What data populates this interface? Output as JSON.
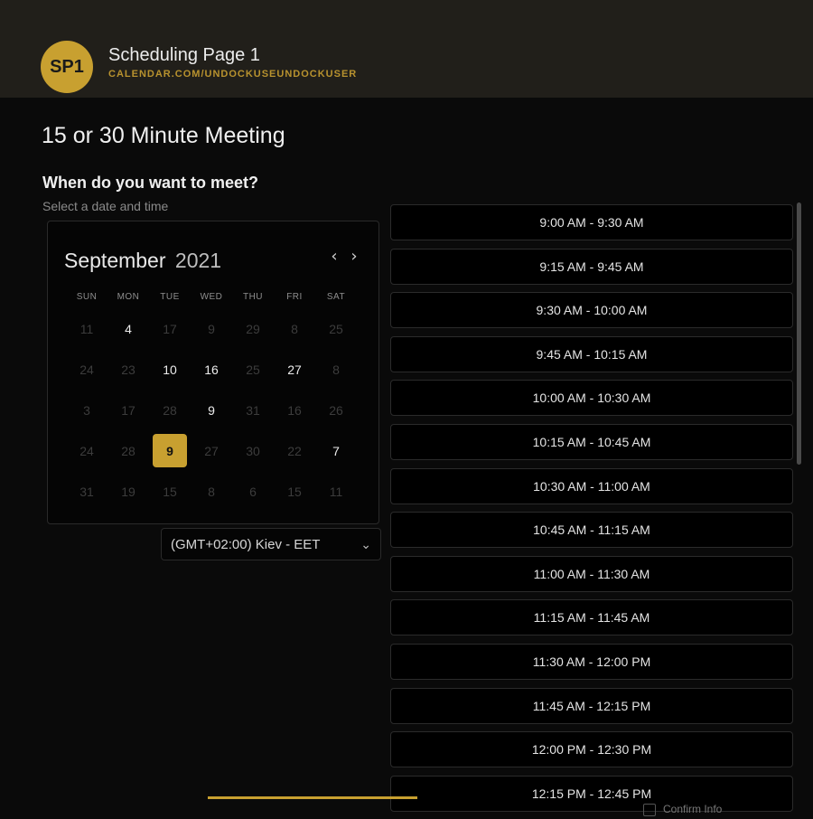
{
  "header": {
    "avatar_initials": "SP1",
    "title": "Scheduling Page 1",
    "url": "CALENDAR.COM/UNDOCKUSEUNDOCKUSER"
  },
  "meeting": {
    "title": "15 or 30 Minute Meeting",
    "question": "When do you want to meet?",
    "subtitle": "Select a date and time"
  },
  "calendar": {
    "month": "September",
    "year": "2021",
    "weekdays": [
      "SUN",
      "MON",
      "TUE",
      "WED",
      "THU",
      "FRI",
      "SAT"
    ],
    "days": [
      [
        {
          "d": "11",
          "s": "off"
        },
        {
          "d": "4",
          "s": "on"
        },
        {
          "d": "17",
          "s": "off"
        },
        {
          "d": "9",
          "s": "off"
        },
        {
          "d": "29",
          "s": "off"
        },
        {
          "d": "8",
          "s": "off"
        },
        {
          "d": "25",
          "s": "off"
        }
      ],
      [
        {
          "d": "24",
          "s": "off"
        },
        {
          "d": "23",
          "s": "off"
        },
        {
          "d": "10",
          "s": "on"
        },
        {
          "d": "16",
          "s": "on"
        },
        {
          "d": "25",
          "s": "off"
        },
        {
          "d": "27",
          "s": "on"
        },
        {
          "d": "8",
          "s": "off"
        }
      ],
      [
        {
          "d": "3",
          "s": "off"
        },
        {
          "d": "17",
          "s": "off"
        },
        {
          "d": "28",
          "s": "off"
        },
        {
          "d": "9",
          "s": "on"
        },
        {
          "d": "31",
          "s": "off"
        },
        {
          "d": "16",
          "s": "off"
        },
        {
          "d": "26",
          "s": "off"
        }
      ],
      [
        {
          "d": "24",
          "s": "off"
        },
        {
          "d": "28",
          "s": "off"
        },
        {
          "d": "9",
          "s": "sel"
        },
        {
          "d": "27",
          "s": "off"
        },
        {
          "d": "30",
          "s": "off"
        },
        {
          "d": "22",
          "s": "off"
        },
        {
          "d": "7",
          "s": "on"
        }
      ],
      [
        {
          "d": "31",
          "s": "off"
        },
        {
          "d": "19",
          "s": "off"
        },
        {
          "d": "15",
          "s": "off"
        },
        {
          "d": "8",
          "s": "off"
        },
        {
          "d": "6",
          "s": "off"
        },
        {
          "d": "15",
          "s": "off"
        },
        {
          "d": "11",
          "s": "off"
        }
      ]
    ],
    "prev_icon": "chevron-left-icon",
    "next_icon": "chevron-right-icon"
  },
  "timezone": {
    "value": "(GMT+02:00) Kiev - EET"
  },
  "slots": [
    "9:00 AM - 9:30 AM",
    "9:15 AM - 9:45 AM",
    "9:30 AM - 10:00 AM",
    "9:45 AM - 10:15 AM",
    "10:00 AM - 10:30 AM",
    "10:15 AM - 10:45 AM",
    "10:30 AM - 11:00 AM",
    "10:45 AM - 11:15 AM",
    "11:00 AM - 11:30 AM",
    "11:15 AM - 11:45 AM",
    "11:30 AM - 12:00 PM",
    "11:45 AM - 12:15 PM",
    "12:00 PM - 12:30 PM",
    "12:15 PM - 12:45 PM"
  ],
  "footer": {
    "confirm_label": "Confirm Info"
  },
  "colors": {
    "accent": "#c8a030",
    "background": "#0a0a0a",
    "header": "#211f1a"
  }
}
